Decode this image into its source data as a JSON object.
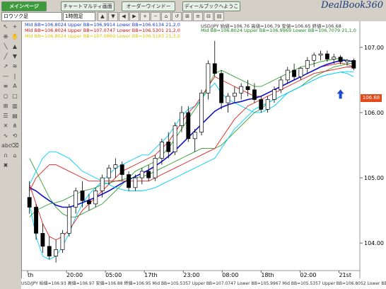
{
  "tabs": [
    {
      "label": "メインページ"
    },
    {
      "label": "チャートマルティ画面"
    },
    {
      "label": "オーダーウインドー"
    },
    {
      "label": "ディールブックへようこそ"
    }
  ],
  "brand": "DealBook360",
  "toolbar": {
    "account_select": "ロウソク足",
    "timeframe_select": "1時間足",
    "buttons": [
      "▲",
      "▼",
      "◀",
      "▶",
      "+",
      "−",
      "⌂",
      "↺",
      "⊞",
      "≡",
      "⊟",
      "▤"
    ]
  },
  "legend": {
    "line1": "Mid BB=106.8024 Upper BB=106.9914 Lower BB=106.6134 21,2,0",
    "line1_right": "USD/JPY 始値=106.76 高値=106.79 安値=106.65 終値=106.68",
    "line2": "Mid BB=106.8024 Upper BB=107.0747 Lower BB=106.5301 21,2,0",
    "line2_right": "Mid BB=106.8024 Upper BB=106.9969 Lower BB=106.7079 21,1,0",
    "line3": "Mid BB=106.8024 Upper BB=107.0869 Lower BB=106.5183 21,3,0"
  },
  "price_tag": "106.68",
  "chart_data": {
    "type": "candlestick",
    "symbol": "USD/JPY",
    "ylim": [
      103.6,
      107.4
    ],
    "yticks": [
      104.0,
      105.0,
      106.0,
      107.0
    ],
    "ytick_labels": [
      "104.00",
      "105.00",
      "106.00",
      "107.00"
    ],
    "xtick_labels": [
      "th",
      "20:00",
      "05:00",
      "17th",
      "23:00",
      "08:00",
      "18th",
      "02:00",
      "21st"
    ],
    "current": 106.68,
    "candles": [
      [
        104.7,
        104.95,
        104.45,
        104.55
      ],
      [
        104.55,
        104.6,
        104.05,
        104.15
      ],
      [
        104.15,
        104.3,
        103.85,
        103.95
      ],
      [
        103.95,
        104.1,
        103.75,
        103.8
      ],
      [
        103.8,
        104.05,
        103.7,
        103.9
      ],
      [
        103.9,
        104.2,
        103.85,
        104.15
      ],
      [
        104.15,
        104.6,
        104.1,
        104.55
      ],
      [
        104.55,
        104.85,
        104.45,
        104.8
      ],
      [
        104.8,
        104.95,
        104.55,
        104.65
      ],
      [
        104.65,
        104.75,
        104.5,
        104.6
      ],
      [
        104.6,
        104.85,
        104.55,
        104.8
      ],
      [
        104.8,
        105.05,
        104.7,
        105.0
      ],
      [
        105.0,
        105.2,
        104.9,
        105.15
      ],
      [
        105.15,
        105.3,
        105.0,
        105.2
      ],
      [
        105.2,
        105.25,
        104.95,
        105.05
      ],
      [
        105.05,
        105.1,
        104.8,
        104.85
      ],
      [
        104.85,
        105.05,
        104.8,
        105.0
      ],
      [
        105.0,
        105.15,
        104.9,
        105.1
      ],
      [
        105.1,
        105.2,
        104.95,
        105.0
      ],
      [
        105.0,
        105.35,
        104.95,
        105.3
      ],
      [
        105.3,
        105.6,
        105.2,
        105.55
      ],
      [
        105.55,
        105.7,
        105.3,
        105.4
      ],
      [
        105.4,
        105.85,
        105.35,
        105.8
      ],
      [
        105.8,
        106.1,
        105.7,
        106.0
      ],
      [
        106.0,
        106.1,
        105.55,
        105.6
      ],
      [
        105.6,
        105.75,
        105.4,
        105.7
      ],
      [
        105.7,
        106.35,
        105.65,
        106.3
      ],
      [
        106.3,
        106.8,
        106.2,
        106.75
      ],
      [
        106.75,
        107.1,
        106.55,
        106.6
      ],
      [
        106.6,
        106.65,
        106.05,
        106.15
      ],
      [
        106.15,
        106.3,
        106.0,
        106.25
      ],
      [
        106.25,
        106.4,
        106.15,
        106.3
      ],
      [
        106.3,
        106.45,
        106.2,
        106.4
      ],
      [
        106.4,
        106.5,
        106.25,
        106.35
      ],
      [
        106.35,
        106.45,
        106.15,
        106.2
      ],
      [
        106.2,
        106.25,
        106.0,
        106.05
      ],
      [
        106.05,
        106.25,
        106.0,
        106.2
      ],
      [
        106.2,
        106.4,
        106.15,
        106.35
      ],
      [
        106.35,
        106.55,
        106.3,
        106.5
      ],
      [
        106.5,
        106.7,
        106.45,
        106.65
      ],
      [
        106.65,
        106.75,
        106.5,
        106.55
      ],
      [
        106.55,
        106.7,
        106.5,
        106.68
      ],
      [
        106.68,
        106.85,
        106.6,
        106.8
      ],
      [
        106.8,
        106.92,
        106.7,
        106.88
      ],
      [
        106.88,
        106.95,
        106.8,
        106.9
      ],
      [
        106.9,
        106.95,
        106.78,
        106.82
      ],
      [
        106.82,
        106.9,
        106.75,
        106.85
      ],
      [
        106.85,
        106.88,
        106.74,
        106.78
      ],
      [
        106.78,
        106.82,
        106.72,
        106.8
      ],
      [
        106.8,
        106.83,
        106.65,
        106.68
      ]
    ],
    "series": [
      {
        "color": "#00cfff",
        "values": [
          104.6,
          104.1,
          103.8,
          103.75,
          103.8,
          103.95,
          104.15,
          104.4,
          104.6,
          104.75,
          104.85,
          104.95,
          105.05,
          105.15,
          105.2,
          105.25,
          105.3,
          105.35,
          105.35,
          105.45,
          105.55,
          105.65,
          105.8,
          105.95,
          106.05,
          106.1,
          106.2,
          106.35,
          106.45,
          106.3,
          106.2,
          106.15,
          106.1,
          106.05,
          106.0,
          106.0,
          106.05,
          106.1,
          106.2,
          106.3,
          106.35,
          106.4,
          106.45,
          106.5,
          106.55,
          106.58,
          106.6,
          106.62,
          106.6,
          106.55
        ]
      },
      {
        "color": "#e02020",
        "values": [
          104.9,
          104.6,
          104.3,
          104.1,
          104.05,
          104.1,
          104.2,
          104.35,
          104.5,
          104.6,
          104.7,
          104.8,
          104.9,
          105.0,
          105.1,
          105.15,
          105.2,
          105.25,
          105.3,
          105.35,
          105.45,
          105.55,
          105.7,
          105.85,
          106.0,
          106.1,
          106.25,
          106.4,
          106.55,
          106.5,
          106.45,
          106.4,
          106.35,
          106.3,
          106.25,
          106.25,
          106.3,
          106.35,
          106.4,
          106.45,
          106.5,
          106.55,
          106.6,
          106.65,
          106.7,
          106.72,
          106.74,
          106.76,
          106.74,
          106.7
        ]
      },
      {
        "color": "#2fa02f",
        "values": [
          105.3,
          105.1,
          104.9,
          104.7,
          104.55,
          104.45,
          104.4,
          104.4,
          104.45,
          104.5,
          104.55,
          104.6,
          104.7,
          104.8,
          104.9,
          105.0,
          105.1,
          105.15,
          105.2,
          105.25,
          105.35,
          105.45,
          105.6,
          105.75,
          105.9,
          106.05,
          106.2,
          106.4,
          106.6,
          106.65,
          106.6,
          106.55,
          106.5,
          106.45,
          106.4,
          106.4,
          106.45,
          106.5,
          106.55,
          106.6,
          106.65,
          106.7,
          106.72,
          106.75,
          106.78,
          106.8,
          106.82,
          106.83,
          106.8,
          106.78
        ]
      },
      {
        "color": "#1010cc",
        "values": [
          104.85,
          104.8,
          104.72,
          104.65,
          104.58,
          104.55,
          104.55,
          104.58,
          104.62,
          104.66,
          104.7,
          104.75,
          104.8,
          104.86,
          104.92,
          104.97,
          105.02,
          105.07,
          105.12,
          105.18,
          105.25,
          105.33,
          105.42,
          105.52,
          105.62,
          105.72,
          105.82,
          105.92,
          106.02,
          106.08,
          106.12,
          106.15,
          106.17,
          106.2,
          106.22,
          106.25,
          106.3,
          106.35,
          106.4,
          106.45,
          106.5,
          106.55,
          106.6,
          106.65,
          106.7,
          106.74,
          106.77,
          106.8,
          106.8,
          106.78
        ]
      },
      {
        "color": "#2fa02f",
        "values": [
          104.4,
          104.5,
          104.55,
          104.6,
          104.62,
          104.65,
          104.7,
          104.75,
          104.8,
          104.82,
          104.85,
          104.9,
          104.92,
          104.95,
          104.97,
          105.0,
          105.0,
          105.02,
          105.05,
          105.1,
          105.15,
          105.2,
          105.25,
          105.3,
          105.35,
          105.4,
          105.45,
          105.45,
          105.45,
          105.5,
          105.6,
          105.7,
          105.8,
          105.9,
          106.0,
          106.05,
          106.15,
          106.2,
          106.25,
          106.3,
          106.35,
          106.4,
          106.48,
          106.55,
          106.6,
          106.65,
          106.7,
          106.72,
          106.75,
          106.76
        ]
      },
      {
        "color": "#e02020",
        "values": [
          104.8,
          105.0,
          105.1,
          105.2,
          105.2,
          105.15,
          105.1,
          105.05,
          105.0,
          104.95,
          104.95,
          104.95,
          104.95,
          104.95,
          104.95,
          104.95,
          104.95,
          104.95,
          104.95,
          105.0,
          105.05,
          105.1,
          105.15,
          105.2,
          105.25,
          105.3,
          105.35,
          105.4,
          105.45,
          105.6,
          105.75,
          105.9,
          106.0,
          106.1,
          106.15,
          106.2,
          106.25,
          106.3,
          106.35,
          106.4,
          106.45,
          106.5,
          106.55,
          106.6,
          106.62,
          106.64,
          106.66,
          106.68,
          106.7,
          106.7
        ]
      },
      {
        "color": "#00cfff",
        "values": [
          104.9,
          105.1,
          105.3,
          105.4,
          105.4,
          105.35,
          105.3,
          105.2,
          105.1,
          105.05,
          105.0,
          104.95,
          104.9,
          104.85,
          104.82,
          104.8,
          104.8,
          104.8,
          104.82,
          104.85,
          104.9,
          104.95,
          105.0,
          105.05,
          105.1,
          105.15,
          105.2,
          105.25,
          105.3,
          105.45,
          105.6,
          105.75,
          105.85,
          105.95,
          106.05,
          106.1,
          106.15,
          106.2,
          106.25,
          106.3,
          106.35,
          106.4,
          106.45,
          106.5,
          106.55,
          106.58,
          106.6,
          106.62,
          106.63,
          106.62
        ]
      }
    ]
  },
  "status": "USD/JPY 始値=106.93 高値=106.97 安値=106.88 終値=106.95  Mid BB=105.5357 Upper BB=107.0747 Lower BB=105.9967 Mid BB=105.5357 Upper BB=106.8052 Lower BB=106.2662"
}
